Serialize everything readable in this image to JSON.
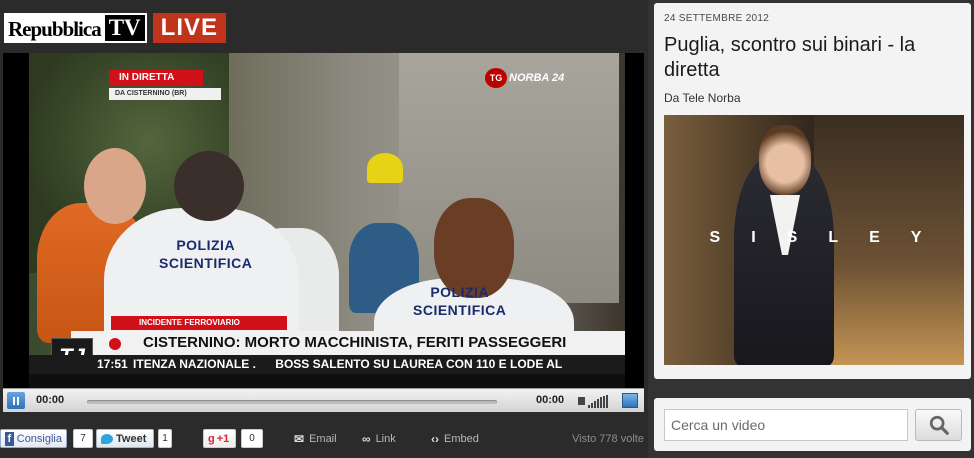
{
  "brand": {
    "name": "Repubblica",
    "tv": "TV",
    "live": "LIVE"
  },
  "video": {
    "badge_live": "IN DIRETTA",
    "badge_location": "DA CISTERNINO (BR)",
    "channel_logo": "TG NORBA 24",
    "channel_tg": "TG",
    "channel_name": "NORBA 24",
    "vest_line1": "POLIZIA",
    "vest_line2": "SCIENTIFICA",
    "category_strap": "INCIDENTE FERROVIARIO",
    "headline": "CISTERNINO: MORTO MACCHINISTA, FERITI PASSEGGERI",
    "tj_logo": "TJ",
    "ticker_time": "17:51",
    "ticker_text_1": "ITENZA NAZIONALE .",
    "ticker_text_2": "BOSS SALENTO SU LAUREA CON 110 E LODE AL"
  },
  "controls": {
    "current_time": "00:00",
    "duration": "00:00",
    "progress": 0
  },
  "social": {
    "facebook_label": "Consiglia",
    "facebook_count": "7",
    "tweet_label": "Tweet",
    "tweet_count": "1",
    "gplus_label": "+1",
    "gplus_count": "0",
    "email_label": "Email",
    "link_label": "Link",
    "embed_label": "Embed",
    "views": "Visto 778 volte"
  },
  "article": {
    "date": "24 SETTEMBRE 2012",
    "title": "Puglia, scontro sui binari - la diretta",
    "source": "Da Tele Norba"
  },
  "ad": {
    "brand": "SISLEY"
  },
  "search": {
    "placeholder": "Cerca un video",
    "value": ""
  },
  "icons": {
    "pause": "pause-icon",
    "fullscreen": "fullscreen-icon",
    "volume": "volume-icon",
    "facebook": "facebook-icon",
    "twitter": "twitter-icon",
    "email": "mail-icon",
    "link": "link-icon",
    "embed": "embed-icon",
    "search": "search-icon"
  },
  "colors": {
    "live_red": "#c1341c",
    "player_blue": "#2e73bd",
    "panel_bg": "#f3f3f3",
    "page_bg": "#333333"
  }
}
